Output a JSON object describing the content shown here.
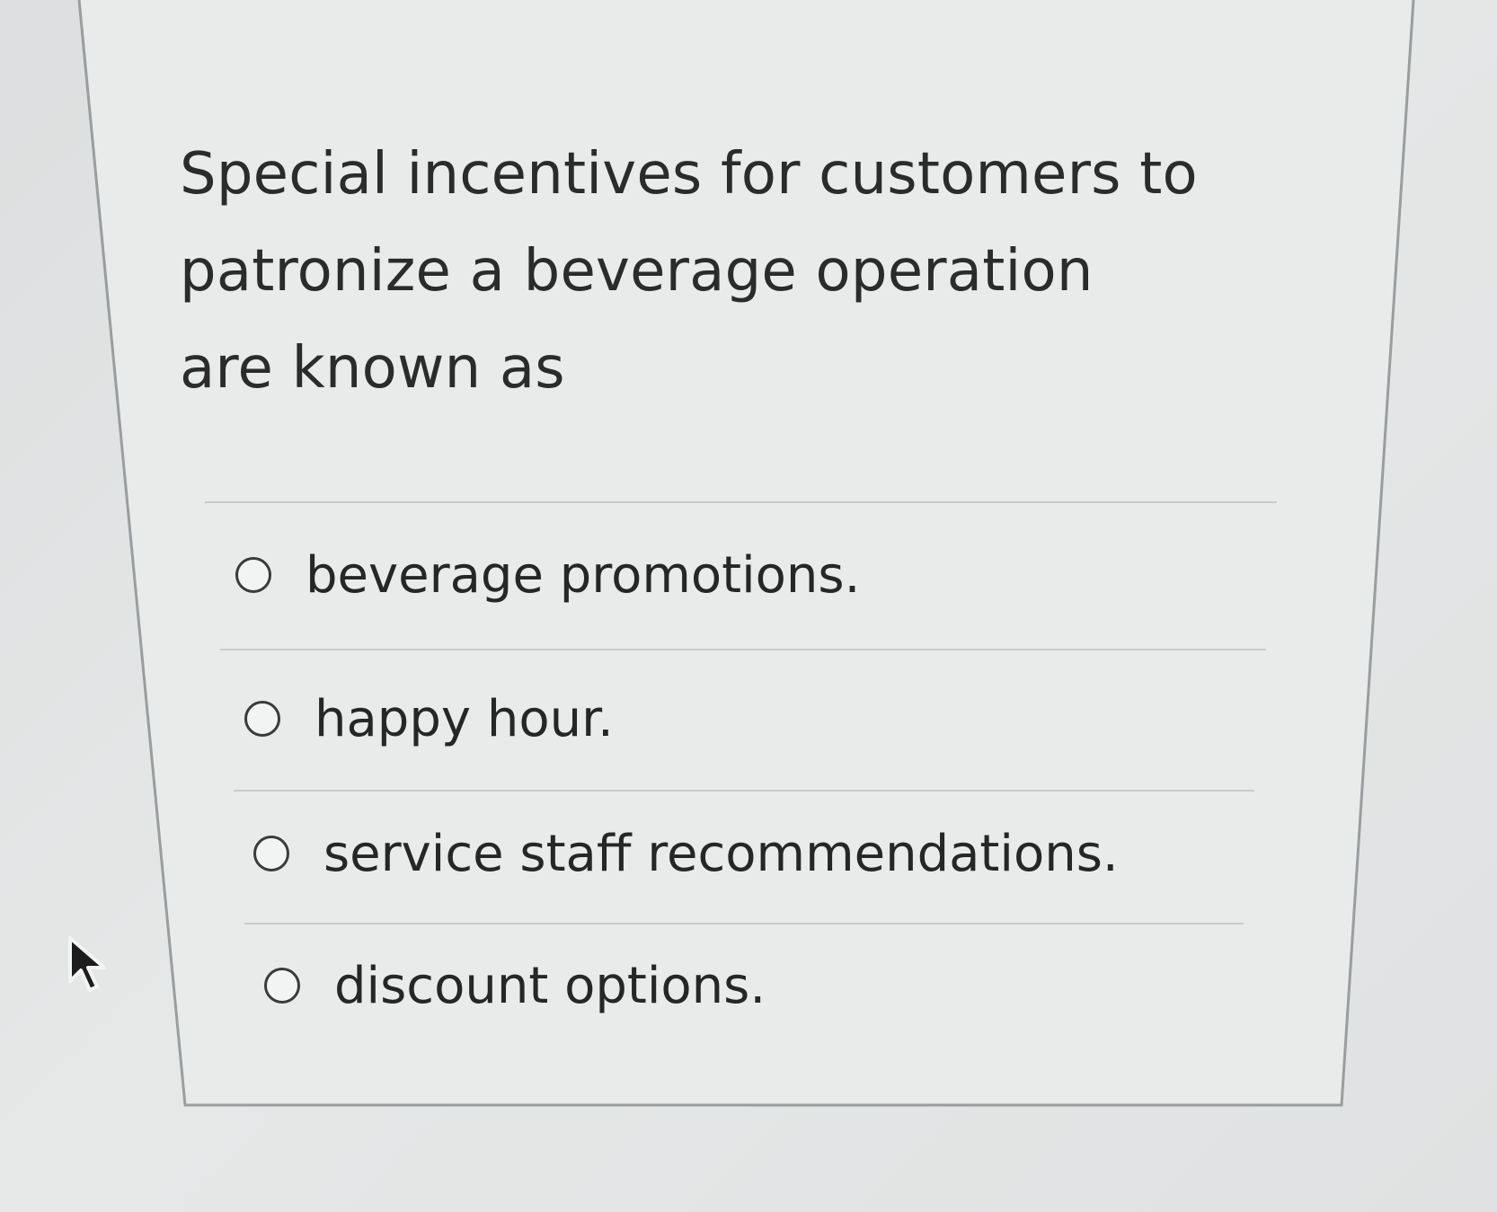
{
  "question": {
    "text": "Special incentives for customers to patronize a beverage operation are known as"
  },
  "options": [
    {
      "label": "beverage promotions.",
      "selected": false
    },
    {
      "label": "happy hour.",
      "selected": false
    },
    {
      "label": "service staff recommendations.",
      "selected": false
    },
    {
      "label": "discount options.",
      "selected": false
    }
  ],
  "icons": {
    "option_marker": "radio-button-icon",
    "pointer": "mouse-cursor-icon"
  },
  "colors": {
    "text": "#262626",
    "card": "#e9ebeb",
    "divider": "#c8cbcc"
  }
}
